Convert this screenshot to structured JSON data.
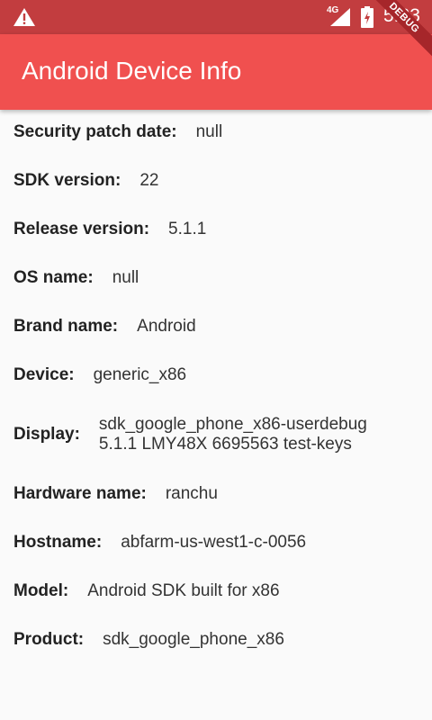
{
  "status_bar": {
    "time": "5:23",
    "network": "4G"
  },
  "app_bar": {
    "title": "Android Device Info",
    "debug_banner": "DEBUG"
  },
  "info": [
    {
      "label": "Security patch date:",
      "value": "null"
    },
    {
      "label": "SDK version:",
      "value": "22"
    },
    {
      "label": "Release version:",
      "value": "5.1.1"
    },
    {
      "label": "OS name:",
      "value": "null"
    },
    {
      "label": "Brand name:",
      "value": "Android"
    },
    {
      "label": "Device:",
      "value": "generic_x86"
    },
    {
      "label": "Display:",
      "value": "sdk_google_phone_x86-userdebug 5.1.1 LMY48X 6695563 test-keys"
    },
    {
      "label": "Hardware name:",
      "value": "ranchu"
    },
    {
      "label": "Hostname:",
      "value": "abfarm-us-west1-c-0056"
    },
    {
      "label": "Model:",
      "value": "Android SDK built for x86"
    },
    {
      "label": "Product:",
      "value": "sdk_google_phone_x86"
    }
  ]
}
